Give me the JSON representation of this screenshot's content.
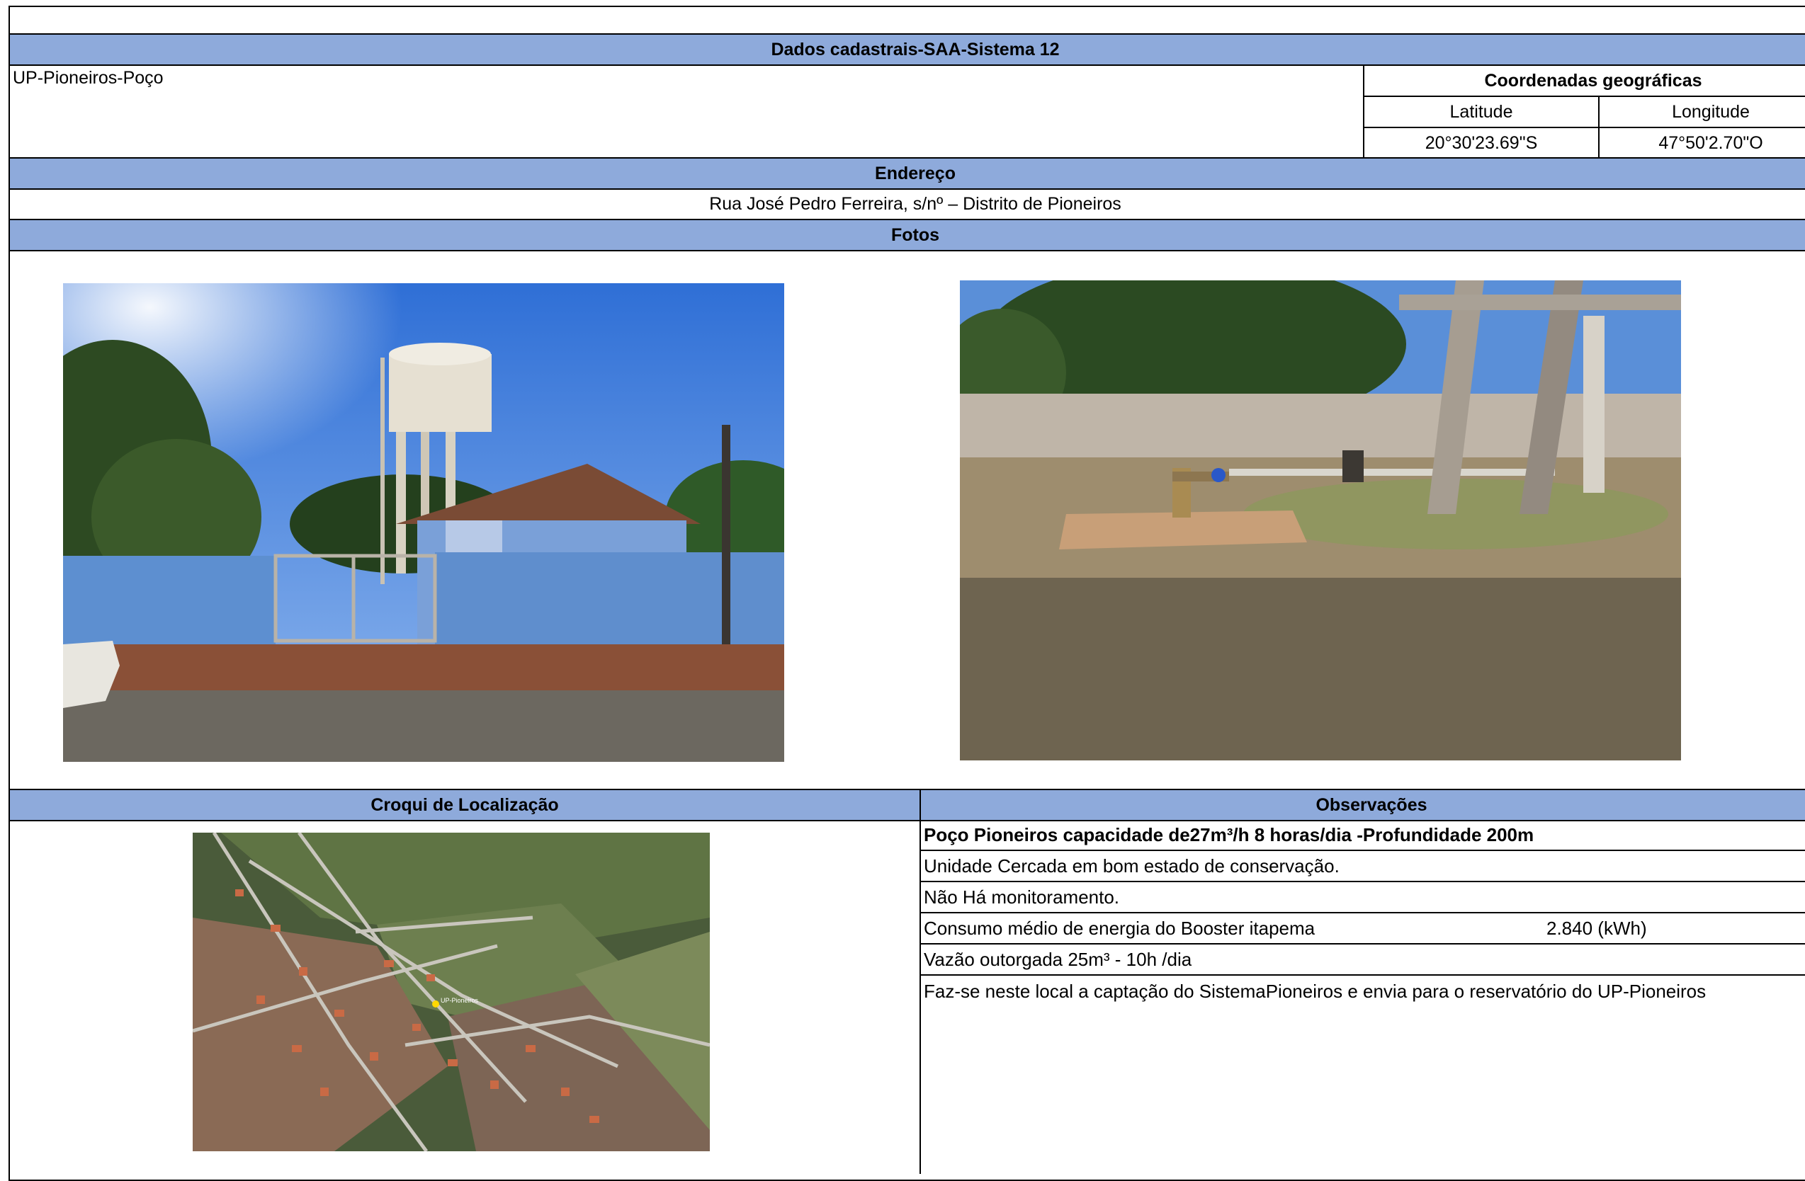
{
  "title": "Dados cadastrais-SAA-Sistema 12",
  "unit_name": "UP-Pioneiros-Poço",
  "coords": {
    "header": "Coordenadas geográficas",
    "lat_label": "Latitude",
    "lon_label": "Longitude",
    "lat_value": "20°30'23.69\"S",
    "lon_value": "47°50'2.70\"O"
  },
  "address": {
    "header": "Endereço",
    "value": "Rua José Pedro Ferreira, s/nº – Distrito de Pioneiros"
  },
  "photos": {
    "header": "Fotos"
  },
  "croqui": {
    "header": "Croqui de Localização",
    "map_label": "UP-Pioneiros"
  },
  "observacoes": {
    "header": "Observações",
    "line1": "Poço Pioneiros  capacidade de27m³/h 8 horas/dia -Profundidade 200m",
    "line2": "Unidade Cercada em bom estado de conservação.",
    "line3": "Não Há monitoramento.",
    "line4_label": "Consumo médio de energia do Booster itapema",
    "line4_value": "2.840  (kWh)",
    "line5": "Vazão outorgada 25m³ - 10h /dia",
    "line6": "Faz-se neste local a captação  do SistemaPioneiros e envia para o reservatório do  UP-Pioneiros"
  },
  "colors": {
    "header_fill": "#8eaadb",
    "border": "#000000"
  }
}
